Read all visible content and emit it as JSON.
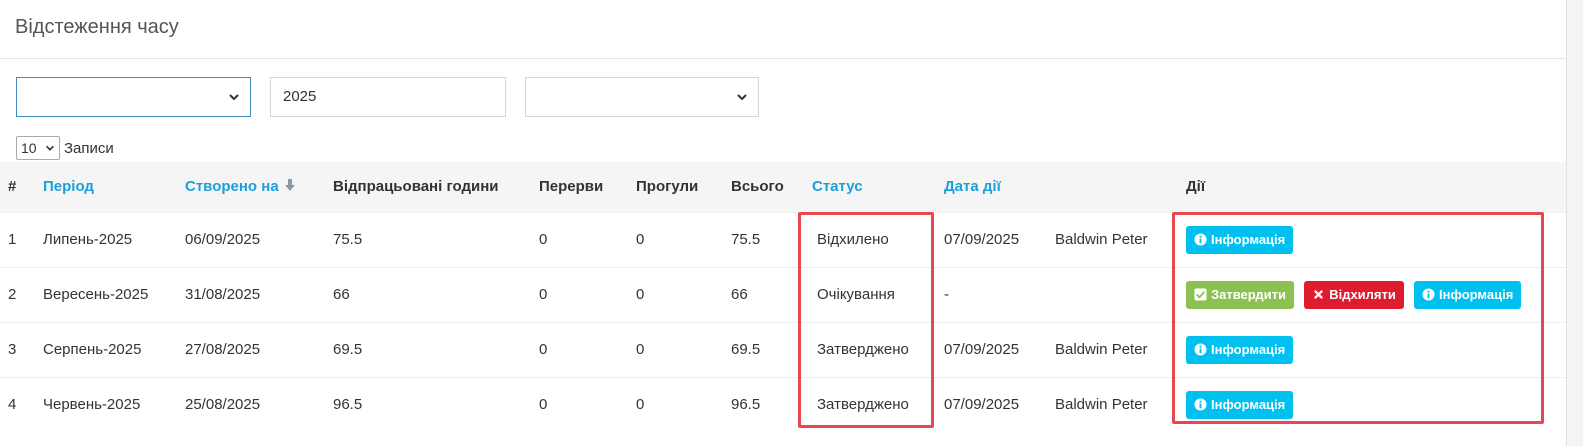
{
  "page": {
    "title": "Відстеження часу"
  },
  "filters": {
    "year_value": "2025"
  },
  "length": {
    "value": "10",
    "label": "Записи"
  },
  "table": {
    "headers": {
      "num": "#",
      "period": "Період",
      "created": "Створено на",
      "worked": "Відпрацьовані години",
      "breaks": "Перерви",
      "absences": "Прогули",
      "total": "Всього",
      "status": "Статус",
      "action_date": "Дата дії",
      "actor": "",
      "actions": "Дії"
    },
    "rows": [
      {
        "num": "1",
        "period": "Липень-2025",
        "created": "06/09/2025",
        "worked": "75.5",
        "breaks": "0",
        "absences": "0",
        "total": "75.5",
        "status": "Відхилено",
        "action_date": "07/09/2025",
        "actor": "Baldwin Peter"
      },
      {
        "num": "2",
        "period": "Вересень-2025",
        "created": "31/08/2025",
        "worked": "66",
        "breaks": "0",
        "absences": "0",
        "total": "66",
        "status": "Очікування",
        "action_date": "-",
        "actor": ""
      },
      {
        "num": "3",
        "period": "Серпень-2025",
        "created": "27/08/2025",
        "worked": "69.5",
        "breaks": "0",
        "absences": "0",
        "total": "69.5",
        "status": "Затверджено",
        "action_date": "07/09/2025",
        "actor": "Baldwin Peter"
      },
      {
        "num": "4",
        "period": "Червень-2025",
        "created": "25/08/2025",
        "worked": "96.5",
        "breaks": "0",
        "absences": "0",
        "total": "96.5",
        "status": "Затверджено",
        "action_date": "07/09/2025",
        "actor": "Baldwin Peter"
      }
    ]
  },
  "buttons": {
    "info": "Інформація",
    "approve": "Затвердити",
    "reject": "Відхиляти"
  },
  "colors": {
    "link": "#1ba0db",
    "info": "#00c0ef",
    "success": "#8cc152",
    "danger": "#dd1c2e",
    "highlight": "#e8474f"
  },
  "icons": {
    "info": "info-circle-icon",
    "approve": "check-square-icon",
    "reject": "times-icon",
    "sort": "arrow-down-icon",
    "select": "chevron-down-icon"
  }
}
